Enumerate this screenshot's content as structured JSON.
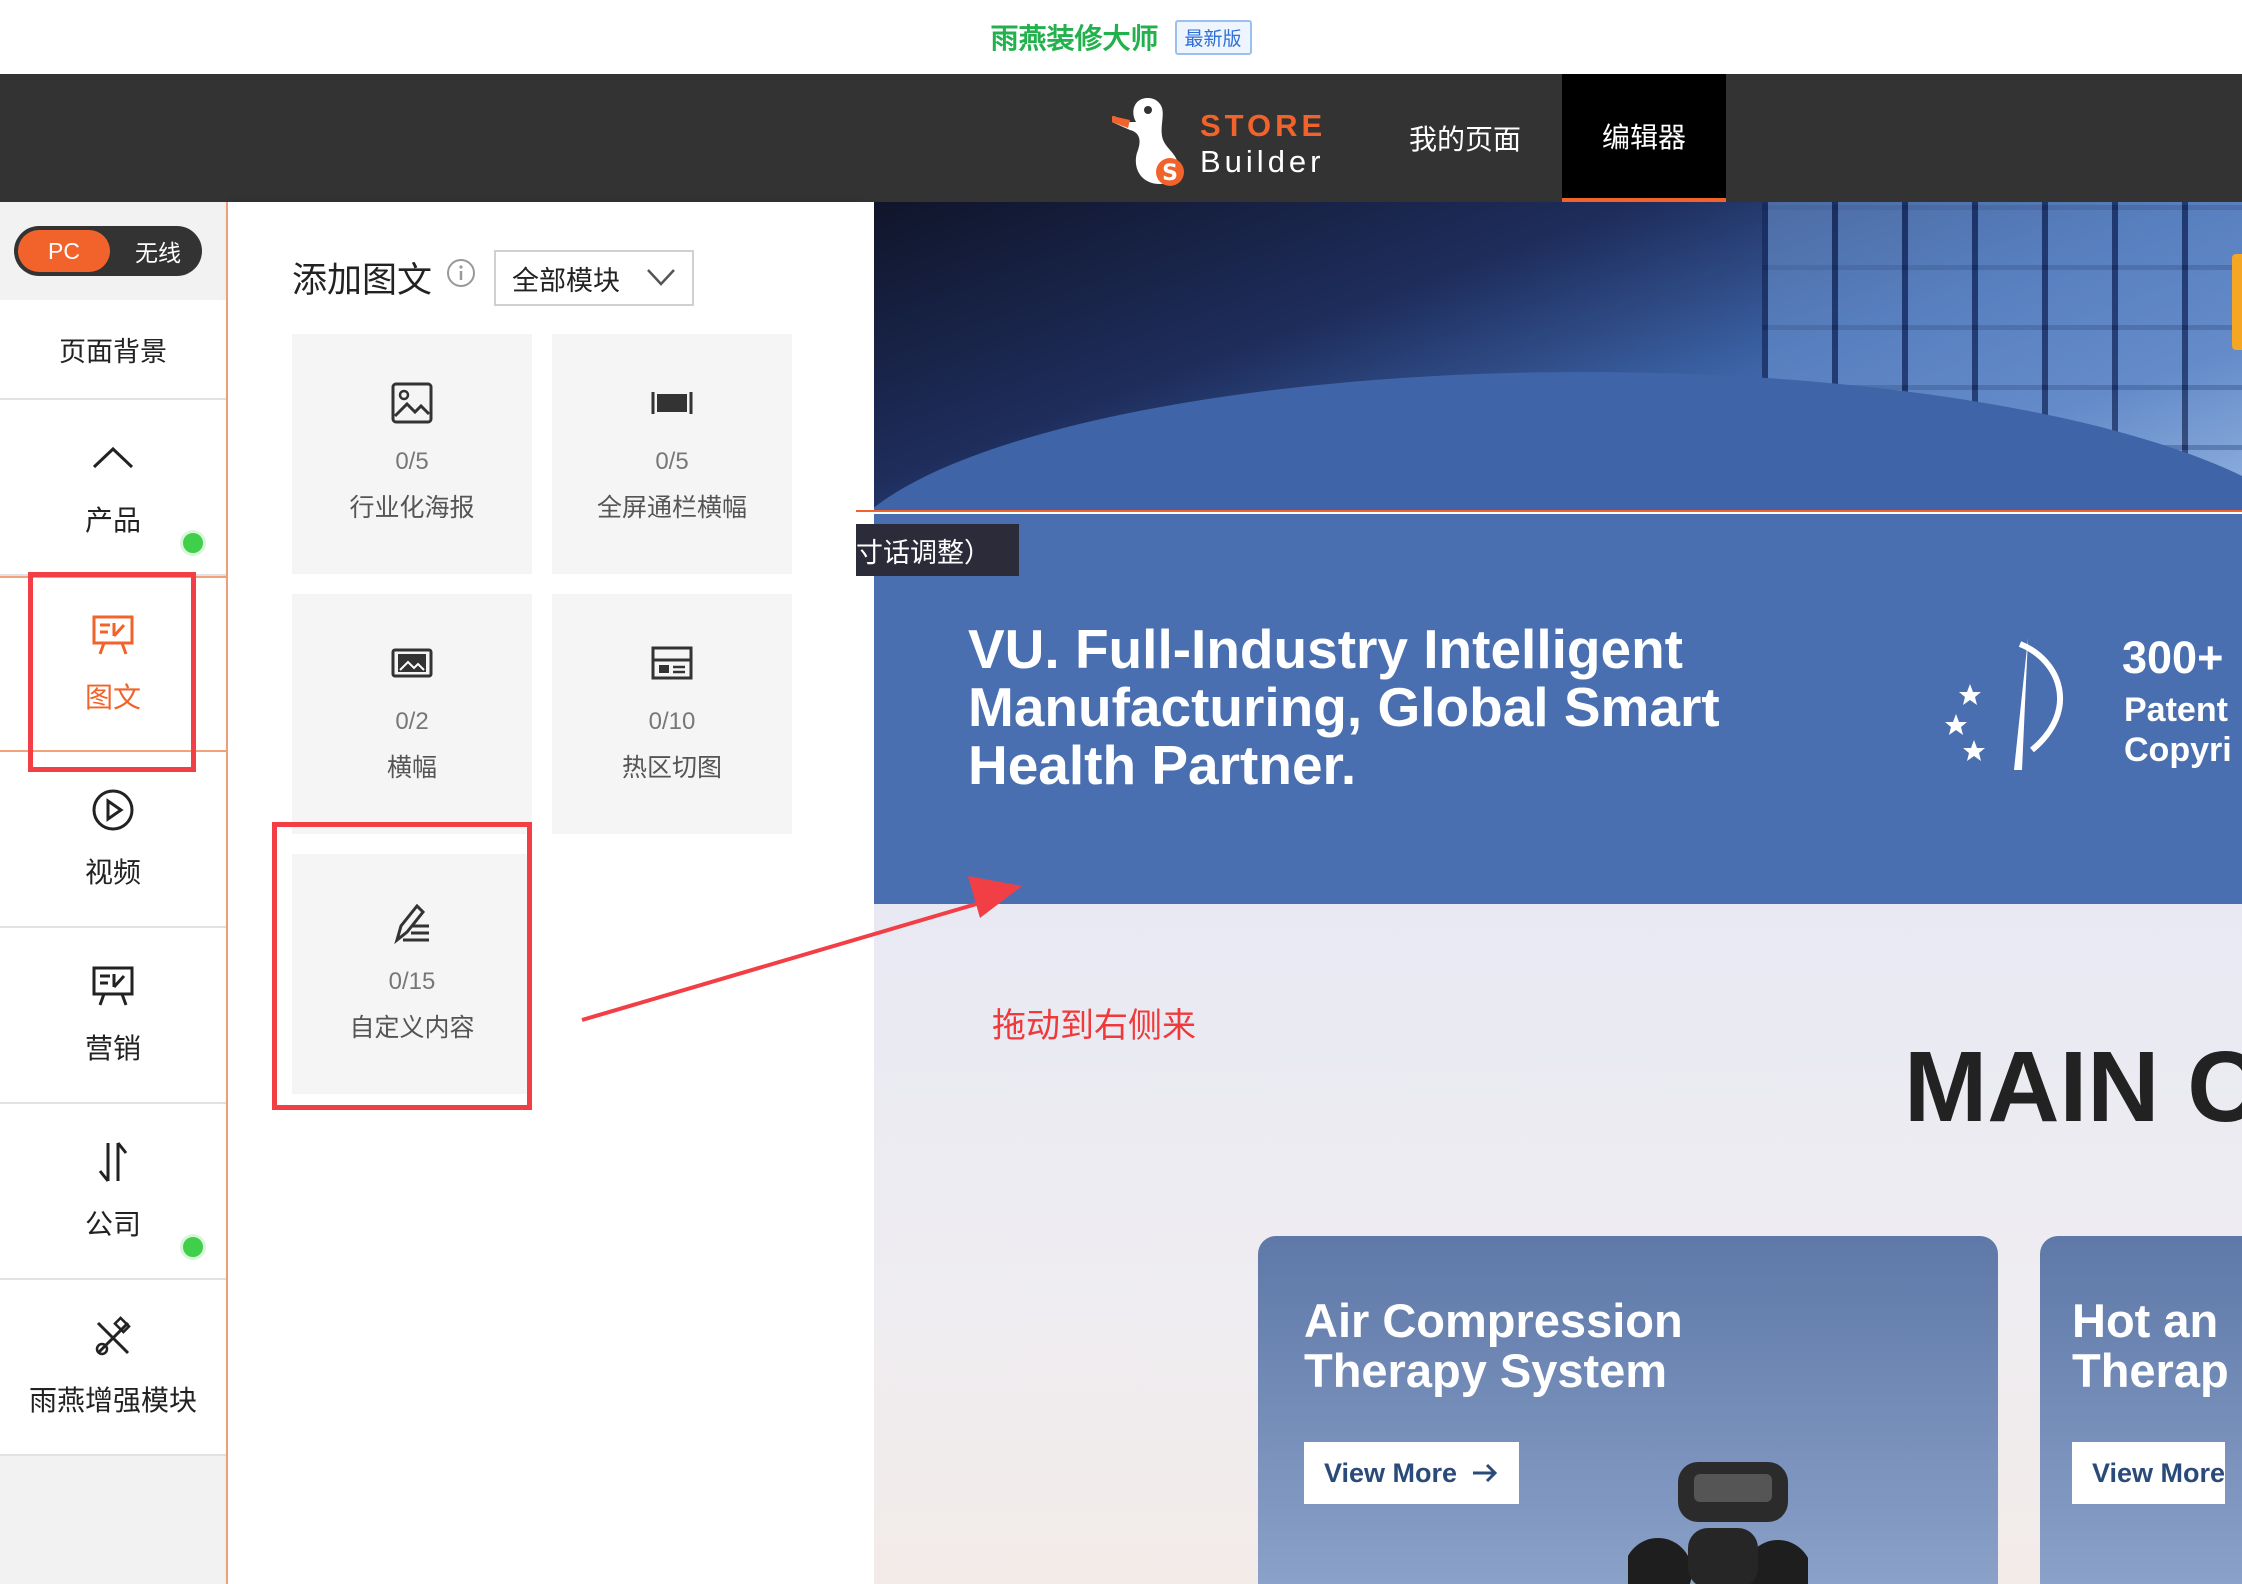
{
  "top_strip": {
    "app_title": "雨燕装修大师",
    "version_badge": "最新版"
  },
  "header": {
    "logo_line1": "STORE",
    "logo_line2": "Builder",
    "nav": [
      {
        "label": "我的页面"
      },
      {
        "label": "编辑器",
        "active": true
      }
    ],
    "accent_color": "#f2632b"
  },
  "sidebar": {
    "toggle": {
      "pc": "PC",
      "wireless": "无线"
    },
    "page_background": "页面背景",
    "items": [
      {
        "label": "产品",
        "icon": "chevron-up-icon",
        "dot": true
      },
      {
        "label": "图文",
        "icon": "image-text-icon",
        "active": true
      },
      {
        "label": "视频",
        "icon": "play-circle-icon"
      },
      {
        "label": "营销",
        "icon": "presentation-icon"
      },
      {
        "label": "公司",
        "icon": "sort-arrows-icon",
        "dot": true
      },
      {
        "label": "雨燕增强模块",
        "icon": "tools-icon"
      }
    ]
  },
  "panel": {
    "title": "添加图文",
    "filter": "全部模块",
    "tiles": [
      {
        "count": "0/5",
        "label": "行业化海报",
        "icon": "image-icon"
      },
      {
        "count": "0/5",
        "label": "全屏通栏横幅",
        "icon": "fullscreen-banner-icon"
      },
      {
        "count": "0/2",
        "label": "横幅",
        "icon": "banner-icon"
      },
      {
        "count": "0/10",
        "label": "热区切图",
        "icon": "hotspot-icon"
      },
      {
        "count": "0/15",
        "label": "自定义内容",
        "icon": "edit-icon"
      }
    ]
  },
  "canvas": {
    "hint_tag": "寸话调整）",
    "band_text": "VU. Full-Industry Intelligent Manufacturing, Global Smart Health Partner.",
    "stat_big": "300+",
    "stat_small_1": "Patent",
    "stat_small_2": "Copyri",
    "drag_hint": "拖动到右侧来",
    "main_heading": "MAIN C",
    "cards": [
      {
        "title_1": "Air Compression",
        "title_2": "Therapy System",
        "button": "View More"
      },
      {
        "title_1": "Hot an",
        "title_2": "Therap",
        "button": "View More"
      }
    ]
  },
  "annotation_color": "#f23f45"
}
